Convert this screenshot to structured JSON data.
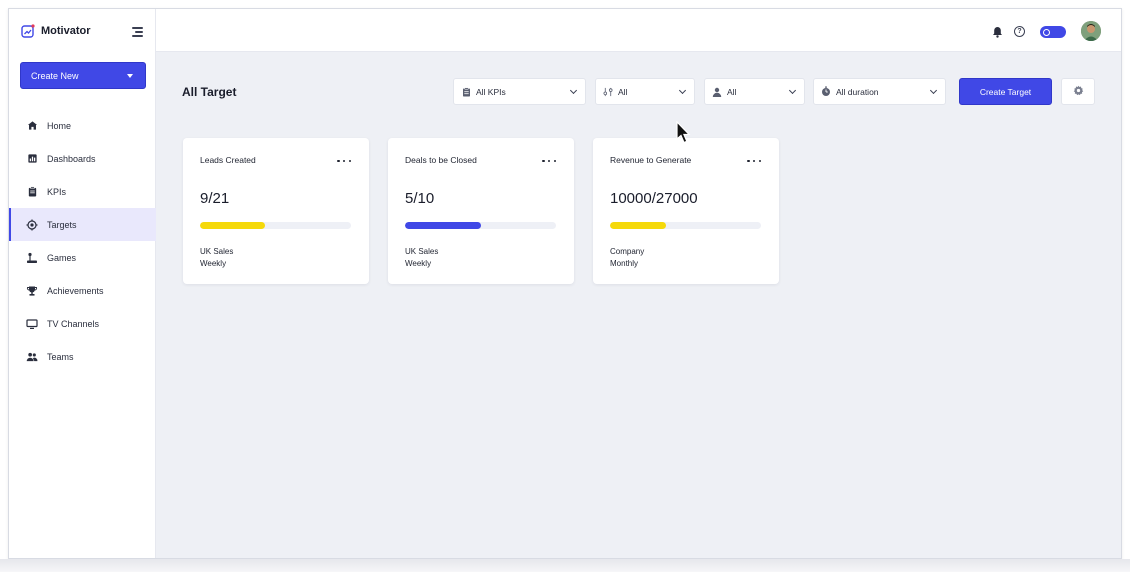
{
  "app": {
    "name": "Motivator",
    "brand_color": "#4048e6"
  },
  "sidebar": {
    "create_new_label": "Create New",
    "items": [
      {
        "label": "Home",
        "icon": "home-icon",
        "active": false
      },
      {
        "label": "Dashboards",
        "icon": "dashboard-icon",
        "active": false
      },
      {
        "label": "KPIs",
        "icon": "clipboard-icon",
        "active": false
      },
      {
        "label": "Targets",
        "icon": "target-icon",
        "active": true
      },
      {
        "label": "Games",
        "icon": "joystick-icon",
        "active": false
      },
      {
        "label": "Achievements",
        "icon": "trophy-icon",
        "active": false
      },
      {
        "label": "TV Channels",
        "icon": "monitor-icon",
        "active": false
      },
      {
        "label": "Teams",
        "icon": "team-icon",
        "active": false
      }
    ]
  },
  "topbar": {
    "icons": [
      "bell-icon",
      "help-icon",
      "theme-toggle",
      "avatar"
    ],
    "help_glyph": "?"
  },
  "main": {
    "title": "All Target",
    "filters": [
      {
        "label": "All KPIs",
        "icon": "clipboard-icon"
      },
      {
        "label": "All",
        "icon": "sliders-icon"
      },
      {
        "label": "All",
        "icon": "user-icon"
      },
      {
        "label": "All duration",
        "icon": "stopwatch-icon"
      }
    ],
    "create_target_label": "Create Target",
    "settings_icon": "gear-icon"
  },
  "cards": [
    {
      "title": "Leads Created",
      "value": "9/21",
      "progress": 0.43,
      "bar_color": "#f5d90a",
      "team": "UK Sales",
      "period": "Weekly"
    },
    {
      "title": "Deals to be Closed",
      "value": "5/10",
      "progress": 0.5,
      "bar_color": "#4048e6",
      "team": "UK Sales",
      "period": "Weekly"
    },
    {
      "title": "Revenue to Generate",
      "value": "10000/27000",
      "progress": 0.37,
      "bar_color": "#f5d90a",
      "team": "Company",
      "period": "Monthly"
    }
  ]
}
